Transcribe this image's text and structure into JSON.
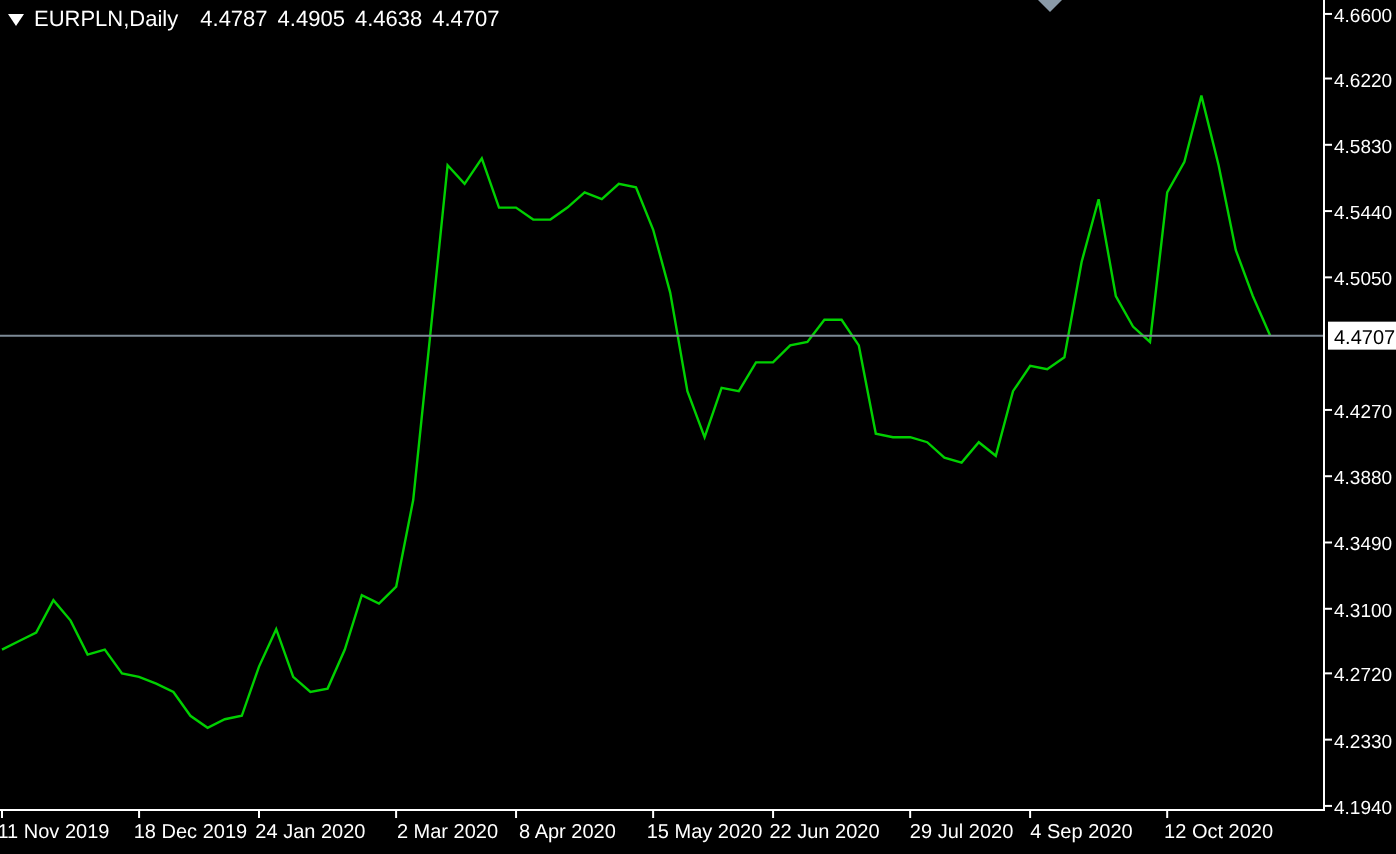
{
  "header": {
    "symbol": "EURPLN,Daily",
    "quotes": [
      "4.4787",
      "4.4905",
      "4.4638",
      "4.4707"
    ]
  },
  "chart": {
    "chart_data": {
      "type": "line",
      "categories": [
        null,
        null,
        null,
        "11 Nov 2019",
        null,
        null,
        null,
        null,
        null,
        null,
        null,
        "18 Dec 2019",
        null,
        null,
        null,
        null,
        null,
        null,
        "24 Jan 2020",
        null,
        null,
        null,
        null,
        null,
        null,
        null,
        "2 Mar 2020",
        null,
        null,
        null,
        null,
        null,
        null,
        "8 Apr 2020",
        null,
        null,
        null,
        null,
        null,
        null,
        null,
        "15 May 2020",
        null,
        null,
        null,
        null,
        null,
        null,
        "22 Jun 2020",
        null,
        null,
        null,
        null,
        null,
        null,
        null,
        "29 Jul 2020",
        null,
        null,
        null,
        null,
        null,
        null,
        "4 Sep 2020",
        null,
        null,
        null,
        null,
        null,
        null,
        null,
        "12 Oct 2020",
        null,
        null,
        null
      ],
      "series": [
        {
          "color": "#00d000",
          "values": [
            4.286,
            4.291,
            4.296,
            4.315,
            4.303,
            4.283,
            4.286,
            4.272,
            4.27,
            4.266,
            4.261,
            4.247,
            4.24,
            4.245,
            4.247,
            4.276,
            4.298,
            4.27,
            4.261,
            4.263,
            4.286,
            4.318,
            4.313,
            4.323,
            4.374,
            4.472,
            4.571,
            4.56,
            4.575,
            4.546,
            4.546,
            4.539,
            4.539,
            4.546,
            4.555,
            4.551,
            4.56,
            4.558,
            4.533,
            4.496,
            4.438,
            4.411,
            4.44,
            4.438,
            4.455,
            4.455,
            4.465,
            4.467,
            4.48,
            4.48,
            4.465,
            4.413,
            4.411,
            4.411,
            4.408,
            4.399,
            4.396,
            4.408,
            4.4,
            4.438,
            4.453,
            4.451,
            4.458,
            4.514,
            4.551,
            4.494,
            4.476,
            4.467,
            4.555,
            4.573,
            4.612,
            4.571,
            4.521,
            4.494,
            4.471
          ]
        }
      ],
      "ylim": [
        4.1916,
        4.6682
      ],
      "yticks": [
        {
          "value": 4.66,
          "label": "4.6600"
        },
        {
          "value": 4.622,
          "label": "4.6220"
        },
        {
          "value": 4.583,
          "label": "4.5830"
        },
        {
          "value": 4.544,
          "label": "4.5440"
        },
        {
          "value": 4.505,
          "label": "4.5050"
        },
        {
          "value": 4.427,
          "label": "4.4270"
        },
        {
          "value": 4.388,
          "label": "4.3880"
        },
        {
          "value": 4.349,
          "label": "4.3490"
        },
        {
          "value": 4.31,
          "label": "4.3100"
        },
        {
          "value": 4.272,
          "label": "4.2720"
        },
        {
          "value": 4.233,
          "label": "4.2330"
        },
        {
          "value": 4.194,
          "label": "4.1940"
        }
      ],
      "ref_lines": [
        {
          "axis": "y",
          "value": 4.4707,
          "label": "4.4707",
          "color": "#7d8a96"
        }
      ]
    }
  }
}
